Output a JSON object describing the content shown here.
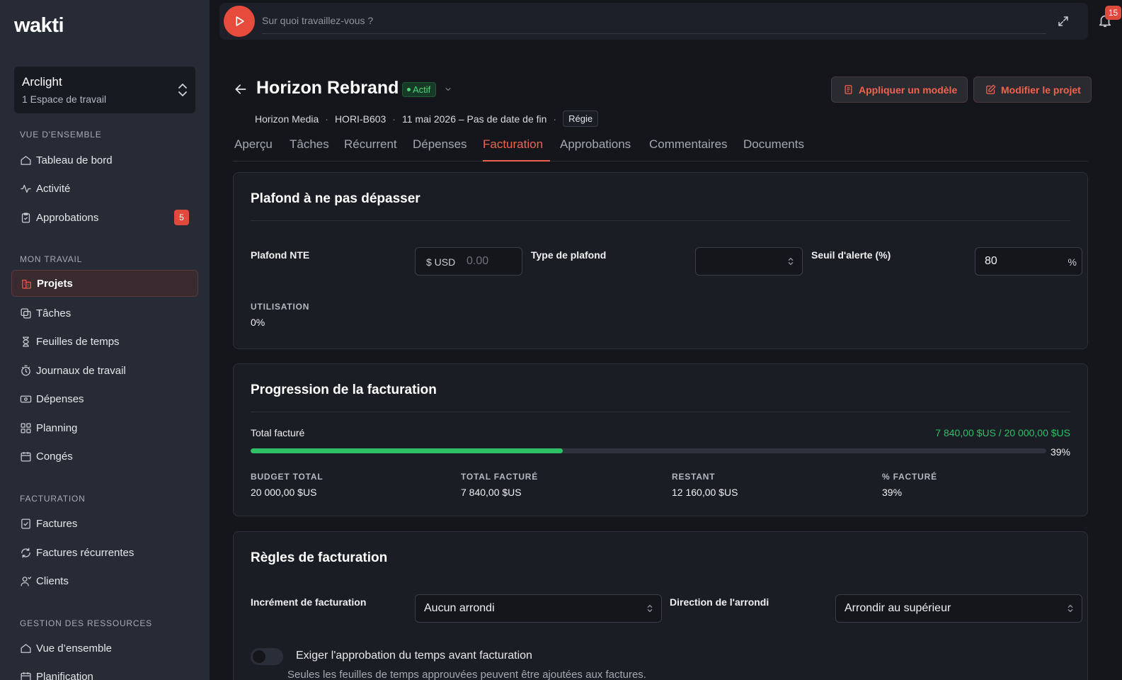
{
  "app": {
    "logo": "wakti"
  },
  "workspace": {
    "name": "Arclight",
    "sub": "1 Espace de travail"
  },
  "sidebar": {
    "sections": [
      "VUE D'ENSEMBLE",
      "MON TRAVAIL",
      "FACTURATION",
      "GESTION DES RESSOURCES"
    ],
    "items": [
      {
        "label": "Tableau de bord",
        "icon": "home-icon"
      },
      {
        "label": "Activité",
        "icon": "activity-icon"
      },
      {
        "label": "Approbations",
        "icon": "clipboard-icon",
        "badge": "5"
      },
      {
        "label": "Projets",
        "icon": "projects-icon",
        "active": true
      },
      {
        "label": "Tâches",
        "icon": "tasks-icon"
      },
      {
        "label": "Feuilles de temps",
        "icon": "hourglass-icon"
      },
      {
        "label": "Journaux de travail",
        "icon": "timer-icon"
      },
      {
        "label": "Dépenses",
        "icon": "banknote-icon"
      },
      {
        "label": "Planning",
        "icon": "grid-icon"
      },
      {
        "label": "Congés",
        "icon": "calendar-icon"
      },
      {
        "label": "Factures",
        "icon": "invoice-icon"
      },
      {
        "label": "Factures récurrentes",
        "icon": "recurring-icon"
      },
      {
        "label": "Clients",
        "icon": "clients-icon"
      },
      {
        "label": "Vue d’ensemble",
        "icon": "home-icon"
      },
      {
        "label": "Planification",
        "icon": "calendar-icon"
      }
    ]
  },
  "topbar": {
    "placeholder": "Sur quoi travaillez-vous ?",
    "notifications": "15"
  },
  "header": {
    "title": "Horizon Rebrand",
    "status": "Actif",
    "client": "Horizon Media",
    "code": "HORI-B603",
    "dates": "11 mai 2026 – Pas de date de fin",
    "billing_type": "Régie",
    "apply_template": "Appliquer un modèle",
    "edit_project": "Modifier le projet"
  },
  "tabs": [
    "Aperçu",
    "Tâches",
    "Récurrent",
    "Dépenses",
    "Facturation",
    "Approbations",
    "Commentaires",
    "Documents"
  ],
  "active_tab": 4,
  "nte": {
    "title": "Plafond à ne pas dépasser",
    "cap_label": "Plafond NTE",
    "currency_prefix": "$ USD",
    "cap_placeholder": "0.00",
    "cap_type_label": "Type de plafond",
    "cap_type_value": "",
    "alert_label": "Seuil d'alerte (%)",
    "alert_value": "80",
    "alert_suffix": "%",
    "usage_label": "UTILISATION",
    "usage_value": "0%"
  },
  "progress": {
    "title": "Progression de la facturation",
    "total_label": "Total facturé",
    "total_ratio": "7 840,00 $US / 20 000,00 $US",
    "percent_text": "39%",
    "fraction": 0.392,
    "accent": "#2fbf66",
    "stats": [
      {
        "label": "BUDGET TOTAL",
        "value": "20 000,00 $US"
      },
      {
        "label": "TOTAL FACTURÉ",
        "value": "7 840,00 $US"
      },
      {
        "label": "RESTANT",
        "value": "12 160,00 $US"
      },
      {
        "label": "% FACTURÉ",
        "value": "39%"
      }
    ]
  },
  "rules": {
    "title": "Règles de facturation",
    "increment_label": "Incrément de facturation",
    "increment_value": "Aucun arrondi",
    "direction_label": "Direction de l'arrondi",
    "direction_value": "Arrondir au supérieur",
    "require_approval_label": "Exiger l'approbation du temps avant facturation",
    "require_approval_desc": "Seules les feuilles de temps approuvées peuvent être ajoutées aux factures."
  },
  "colors": {
    "brand": "#e64b3c",
    "accent": "#f0634f",
    "success": "#2fbf66"
  }
}
